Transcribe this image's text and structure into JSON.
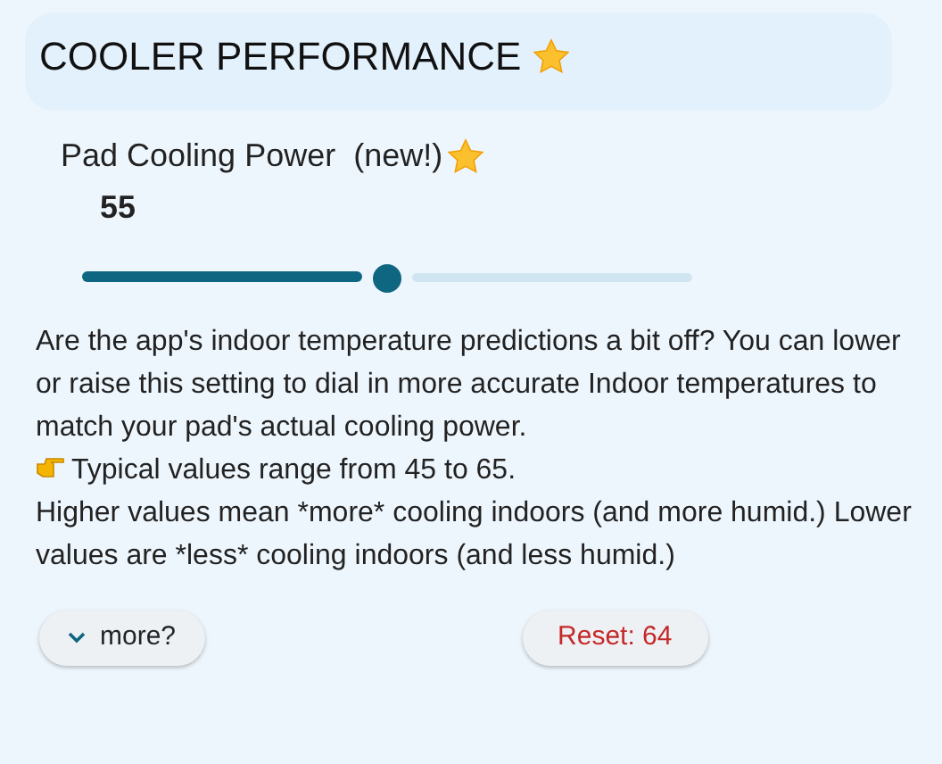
{
  "section": {
    "title": "COOLER PERFORMANCE",
    "starred": true
  },
  "setting": {
    "label": "Pad Cooling Power  (new!)",
    "starred": true,
    "value": "55",
    "level": 0.5
  },
  "description": [
    {
      "kind": "text",
      "text": "Are the app's indoor temperature predictions a bit off? You can lower or raise this setting to dial in more accurate Indoor temperatures to match your pad's actual cooling power."
    },
    {
      "kind": "pointer",
      "text": "Typical values range from 45 to 65."
    },
    {
      "kind": "text",
      "text": "Higher values mean *more* cooling indoors (and more humid.)  Lower values are *less* cooling indoors (and less humid.)"
    }
  ],
  "buttons": [
    {
      "kind": "expand",
      "label": "more?"
    },
    {
      "kind": "reset",
      "label": "Reset: 64"
    }
  ]
}
